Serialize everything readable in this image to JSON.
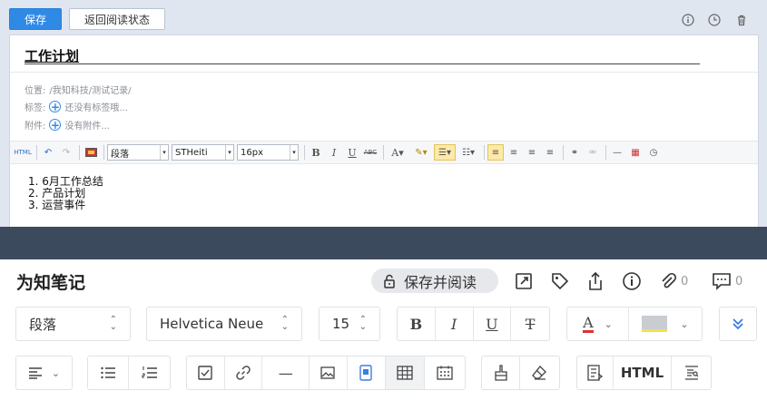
{
  "top_toolbar": {
    "save_label": "保存",
    "back_label": "返回阅读状态"
  },
  "note": {
    "title": "工作计划",
    "location_label": "位置:",
    "location_value": "/我知科技/测试记录/",
    "tags_label": "标签:",
    "tags_placeholder": "还没有标签哦...",
    "attachments_label": "附件:",
    "attachments_placeholder": "没有附件..."
  },
  "editor_toolbar": {
    "html_label": "HTML",
    "paragraph_value": "段落",
    "font_value": "STHeiti",
    "size_value": "16px"
  },
  "content": {
    "list": [
      "6月工作总结",
      "产品计划",
      "运营事件"
    ]
  },
  "bottom": {
    "app_name": "为知笔记",
    "save_read_label": "保存并阅读",
    "attachment_count": "0",
    "comment_count": "0",
    "paragraph_value": "段落",
    "font_value": "Helvetica Neue",
    "size_value": "15",
    "html_label": "HTML"
  },
  "colors": {
    "accent": "#2f8ae6",
    "band": "#3c4a5e",
    "top_bg": "#e0e6ef"
  }
}
